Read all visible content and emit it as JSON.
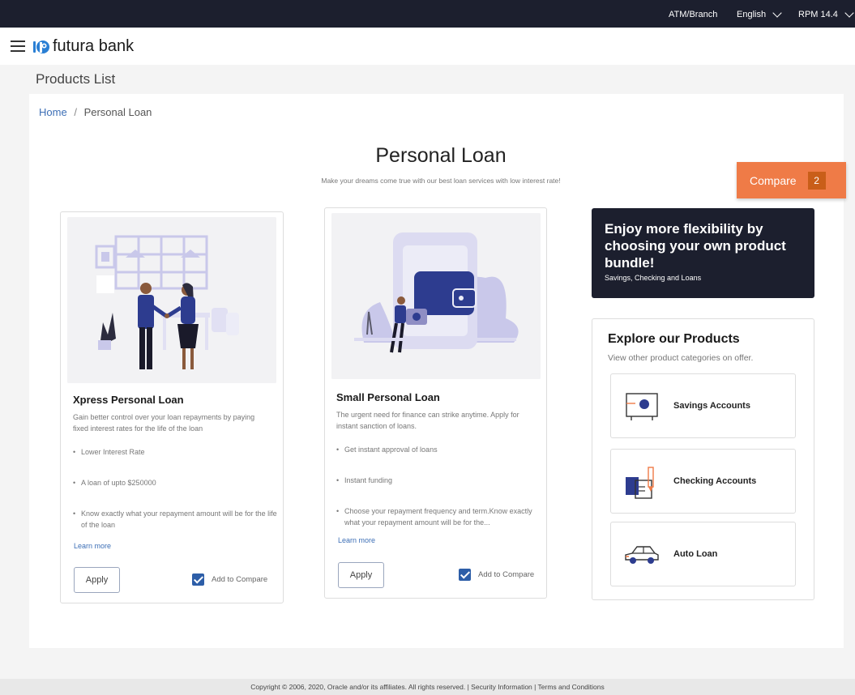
{
  "topbar": {
    "atm_branch": "ATM/Branch",
    "language": "English",
    "user": "RPM 14.4"
  },
  "brand": {
    "name": "futura bank"
  },
  "page": {
    "title": "Products List"
  },
  "breadcrumb": {
    "home": "Home",
    "separator": "/",
    "current": "Personal Loan"
  },
  "heading": {
    "title": "Personal Loan",
    "subtitle": "Make your dreams come true with our best loan services with low interest rate!"
  },
  "compare": {
    "label": "Compare",
    "count": "2"
  },
  "products": [
    {
      "title": "Xpress Personal Loan",
      "description": "Gain better control over your loan repayments by paying fixed interest rates for the life of the loan",
      "features": [
        "Lower Interest Rate",
        "A loan of upto $250000",
        "Know exactly what your repayment amount will be for the life of the loan"
      ],
      "learn_more": "Learn more",
      "apply": "Apply",
      "compare_label": "Add to Compare",
      "compare_checked": true
    },
    {
      "title": "Small Personal Loan",
      "description": "The urgent need for finance can strike anytime. Apply for instant sanction of loans.",
      "features": [
        "Get instant approval of loans",
        "Instant funding",
        "Choose your repayment frequency and term.Know exactly what your repayment amount will be for the..."
      ],
      "learn_more": "Learn more",
      "apply": "Apply",
      "compare_label": "Add to Compare",
      "compare_checked": true
    }
  ],
  "promo": {
    "title": "Enjoy more flexibility by choosing your own product bundle!",
    "subtitle": "Savings, Checking and Loans"
  },
  "explore": {
    "title": "Explore our Products",
    "subtitle": "View other product categories on offer.",
    "categories": [
      {
        "label": "Savings Accounts",
        "icon": "safe-icon"
      },
      {
        "label": "Checking Accounts",
        "icon": "checkbook-icon"
      },
      {
        "label": "Auto Loan",
        "icon": "car-icon"
      }
    ]
  },
  "footer": {
    "text": "Copyright © 2006, 2020, Oracle and/or its affiliates. All rights reserved. | Security Information | Terms and Conditions"
  },
  "colors": {
    "topbar": "#1c1f2e",
    "accent_orange": "#ef7b47",
    "link_blue": "#3d6fb6",
    "illustration_navy": "#2d3c8f",
    "illustration_lavender": "#c9c8ea"
  }
}
